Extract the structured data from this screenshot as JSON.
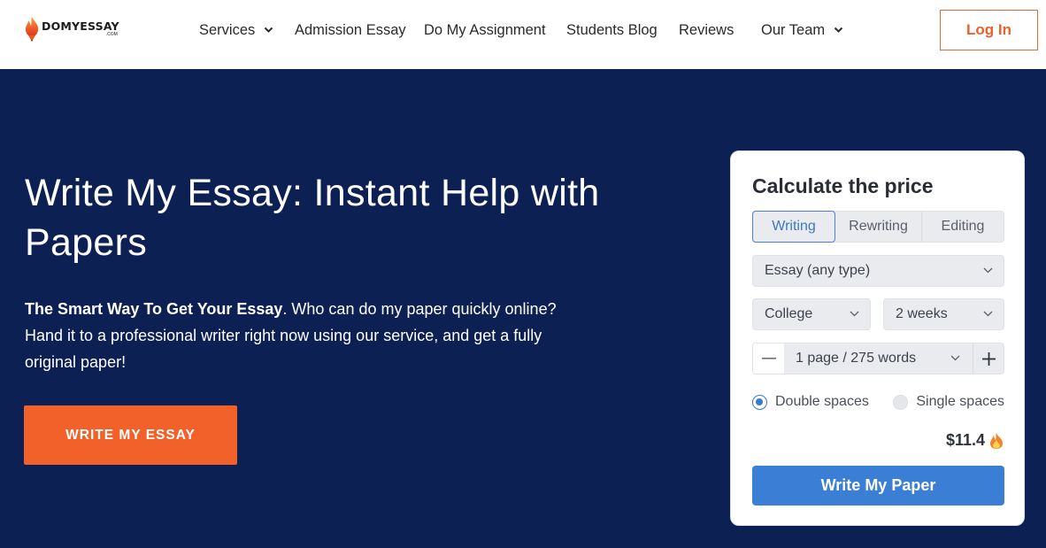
{
  "header": {
    "logo": {
      "name": "DOMYESSAY",
      "suffix": ".COM",
      "icon": "flame-pencil-icon"
    },
    "nav": [
      {
        "label": "Services",
        "has_dropdown": true
      },
      {
        "label": "Admission Essay",
        "has_dropdown": false
      },
      {
        "label": "Do My Assignment",
        "has_dropdown": false
      },
      {
        "label": "Students Blog",
        "has_dropdown": false
      },
      {
        "label": "Reviews",
        "has_dropdown": false
      },
      {
        "label": "Our Team",
        "has_dropdown": true
      }
    ],
    "login_label": "Log In"
  },
  "hero": {
    "title": "Write My Essay: Instant Help with Papers",
    "desc_bold": "The Smart Way To Get Your Essay",
    "desc_rest": ". Who can do my paper quickly online? Hand it to a professional writer right now using our service, and get a fully original paper!",
    "cta_label": "WRITE MY ESSAY"
  },
  "calculator": {
    "title": "Calculate the price",
    "tabs": [
      {
        "label": "Writing",
        "active": true
      },
      {
        "label": "Rewriting",
        "active": false
      },
      {
        "label": "Editing",
        "active": false
      }
    ],
    "paper_type": "Essay (any type)",
    "academic_level": "College",
    "deadline": "2 weeks",
    "pages": "1 page / 275 words",
    "minus_icon": "minus-icon",
    "plus_icon": "plus-icon",
    "spacing": [
      {
        "label": "Double spaces",
        "selected": true
      },
      {
        "label": "Single spaces",
        "selected": false
      }
    ],
    "price": "$11.4",
    "price_icon": "fire-icon",
    "submit_label": "Write My Paper"
  },
  "colors": {
    "hero_bg": "#0d2054",
    "accent_orange": "#f2612a",
    "accent_blue": "#3a7fd5"
  }
}
